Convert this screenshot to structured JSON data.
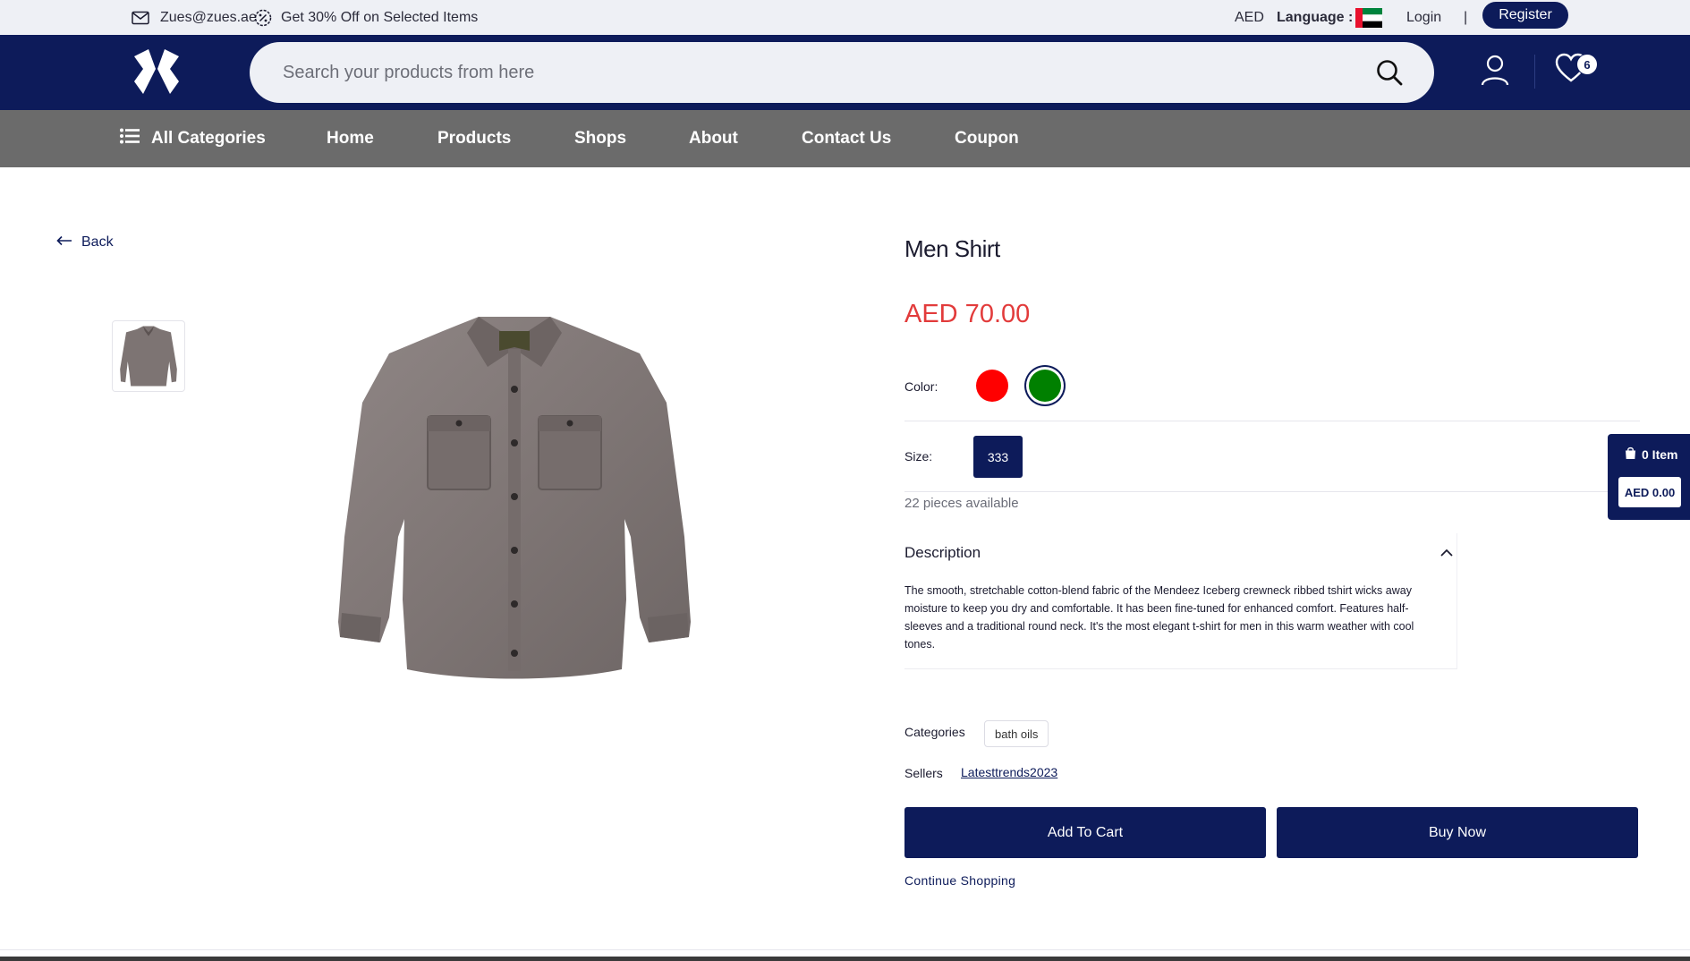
{
  "topbar": {
    "email": "Zues@zues.ae",
    "promo": "Get 30% Off on Selected Items",
    "currency": "AED",
    "language_label": "Language :",
    "login": "Login",
    "separator": "|",
    "register": "Register"
  },
  "header": {
    "search_placeholder": "Search your products from here",
    "wishlist_count": "6",
    "brand_color": "#0d1b5a"
  },
  "nav": {
    "all_categories": "All Categories",
    "items": [
      "Home",
      "Products",
      "Shops",
      "About",
      "Contact Us",
      "Coupon"
    ]
  },
  "product": {
    "back_label": "Back",
    "title": "Men Shirt",
    "price": "AED 70.00",
    "price_color": "#e23b3b",
    "color_label": "Color:",
    "colors": [
      {
        "name": "red",
        "hex": "#ff0000",
        "selected": false
      },
      {
        "name": "green",
        "hex": "#008000",
        "selected": true
      }
    ],
    "size_label": "Size:",
    "size_value": "333",
    "availability": "22 pieces available",
    "description_title": "Description",
    "description_text": "The smooth, stretchable cotton-blend fabric of the Mendeez Iceberg crewneck ribbed tshirt wicks away moisture to keep you dry and comfortable. It has been fine-tuned for enhanced comfort. Features half-sleeves and a traditional round neck. It's the most elegant t-shirt for men in this warm weather with cool tones.",
    "categories_label": "Categories",
    "category_tag": "bath oils",
    "sellers_label": "Sellers",
    "seller_name": "Latesttrends2023",
    "add_to_cart": "Add To Cart",
    "buy_now": "Buy Now",
    "continue_shopping": "Continue Shopping"
  },
  "floating_cart": {
    "items": "0 Item",
    "total": "AED 0.00"
  }
}
